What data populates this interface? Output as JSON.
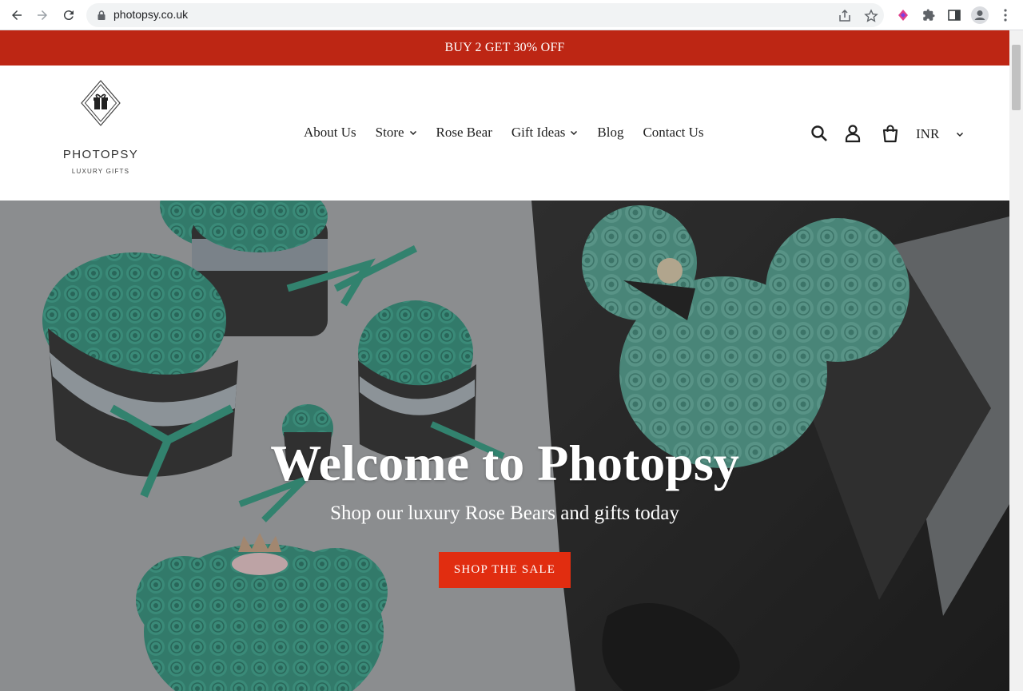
{
  "browser": {
    "url": "photopsy.co.uk"
  },
  "announcement": {
    "text": "BUY 2 GET 30% OFF"
  },
  "logo": {
    "name": "PHOTOPSY",
    "tagline": "LUXURY GIFTS"
  },
  "nav": {
    "items": [
      {
        "label": "About Us",
        "dropdown": false
      },
      {
        "label": "Store",
        "dropdown": true
      },
      {
        "label": "Rose Bear",
        "dropdown": false
      },
      {
        "label": "Gift Ideas",
        "dropdown": true
      },
      {
        "label": "Blog",
        "dropdown": false
      },
      {
        "label": "Contact Us",
        "dropdown": false
      }
    ]
  },
  "header_icons": [
    "search-icon",
    "account-icon",
    "cart-icon"
  ],
  "currency": {
    "selected": "INR"
  },
  "hero": {
    "title": "Welcome to Photopsy",
    "subtitle": "Shop our luxury Rose Bears and gifts today",
    "button_label": "SHOP THE SALE"
  },
  "colors": {
    "announcement_bg": "#bd2614",
    "button_bg": "#e12d10",
    "rose_teal": "#3aa48c"
  }
}
